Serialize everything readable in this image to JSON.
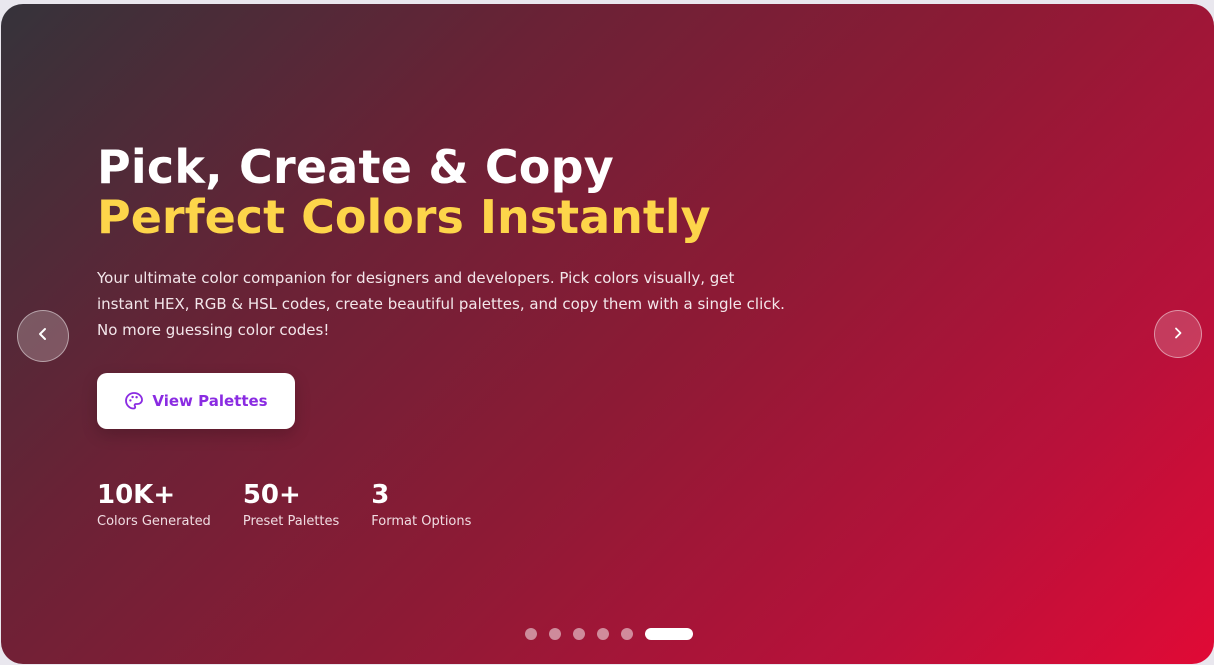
{
  "hero": {
    "title_line_1": "Pick, Create & Copy",
    "title_line_2": "Perfect Colors Instantly",
    "description": "Your ultimate color companion for designers and developers. Pick colors visually, get instant HEX, RGB & HSL codes, create beautiful palettes, and copy them with a single click. No more guessing color codes!",
    "cta": {
      "label": "View Palettes",
      "icon": "palette-icon"
    },
    "stats": [
      {
        "value": "10K+",
        "label": "Colors Generated"
      },
      {
        "value": "50+",
        "label": "Preset Palettes"
      },
      {
        "value": "3",
        "label": "Format Options"
      }
    ]
  },
  "carousel": {
    "prev_icon": "chevron-left-icon",
    "next_icon": "chevron-right-icon",
    "slide_count": 6,
    "active_slide": 6
  },
  "colors": {
    "accent_title": "#fdd54a",
    "button_text": "#8a2be2",
    "gradient_start": "#35333a",
    "gradient_end": "#e10a36"
  }
}
